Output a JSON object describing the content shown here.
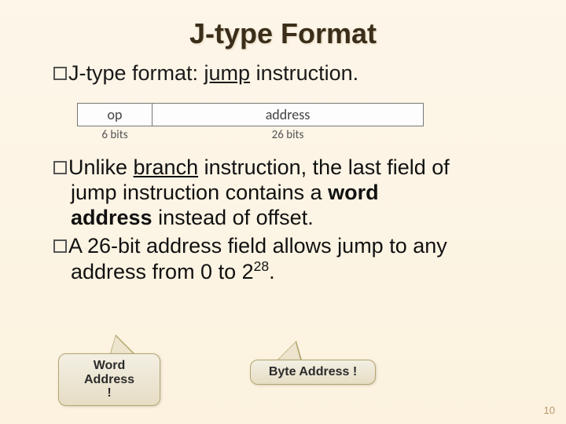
{
  "title": "J-type Format",
  "line1_a": "J-type format: ",
  "line1_b": "jump",
  "line1_c": " instruction.",
  "diagram": {
    "op": "op",
    "addr": "address",
    "op_bits": "6 bits",
    "addr_bits": "26 bits"
  },
  "para1_a": "Unlike ",
  "para1_b": "branch",
  "para1_c": " instruction, the last field of",
  "para1_d": "jump instruction contains a ",
  "para1_e": "word",
  "para1_f": "address",
  "para1_g": " instead of offset.",
  "para2_a": "A 26-bit address field allows jump to any",
  "para2_b": "address from 0 to 2",
  "para2_exp": "28",
  "para2_c": ".",
  "callout1_a": "Word Address",
  "callout1_b": "!",
  "callout2": "Byte Address !",
  "page": "10"
}
